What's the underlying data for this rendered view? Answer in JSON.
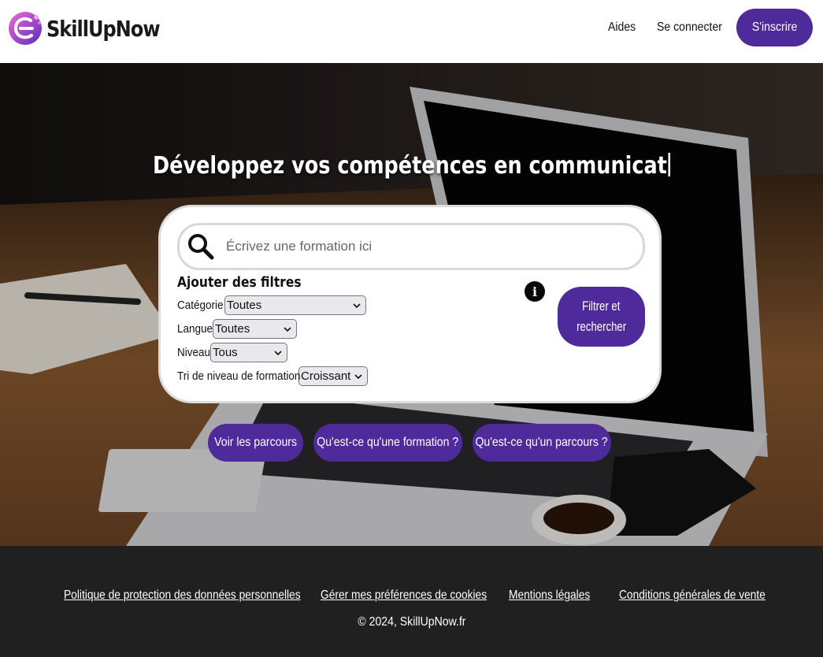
{
  "header": {
    "brand": "SkillUpNow",
    "nav": {
      "help": "Aides",
      "login": "Se connecter",
      "signup": "S'inscrire"
    }
  },
  "hero": {
    "headline": "Développez vos compétences en communicat",
    "search": {
      "placeholder": "Écrivez une formation ici"
    },
    "filters": {
      "title": "Ajouter des filtres",
      "category": {
        "label": "Catégorie",
        "value": "Toutes"
      },
      "language": {
        "label": "Langue",
        "value": "Toutes"
      },
      "level": {
        "label": "Niveau",
        "value": "Tous"
      },
      "sort": {
        "label": "Tri de niveau de formation",
        "value": "Croissant"
      }
    },
    "info_icon_glyph": "i",
    "filter_button": {
      "line1": "Filtrer et",
      "line2": "rechercher"
    },
    "links": {
      "paths": "Voir les parcours",
      "what_training": "Qu'est-ce qu'une formation ?",
      "what_path": "Qu'est-ce qu'un parcours ?"
    }
  },
  "footer": {
    "privacy": "Politique de protection des données personnelles",
    "cookies": "Gérer mes préférences de cookies",
    "legal": "Mentions légales",
    "terms": "Conditions générales de vente",
    "copyright": "© 2024, SkillUpNow.fr"
  },
  "colors": {
    "accent": "#4f2a9a",
    "footer_bg": "#202020"
  }
}
